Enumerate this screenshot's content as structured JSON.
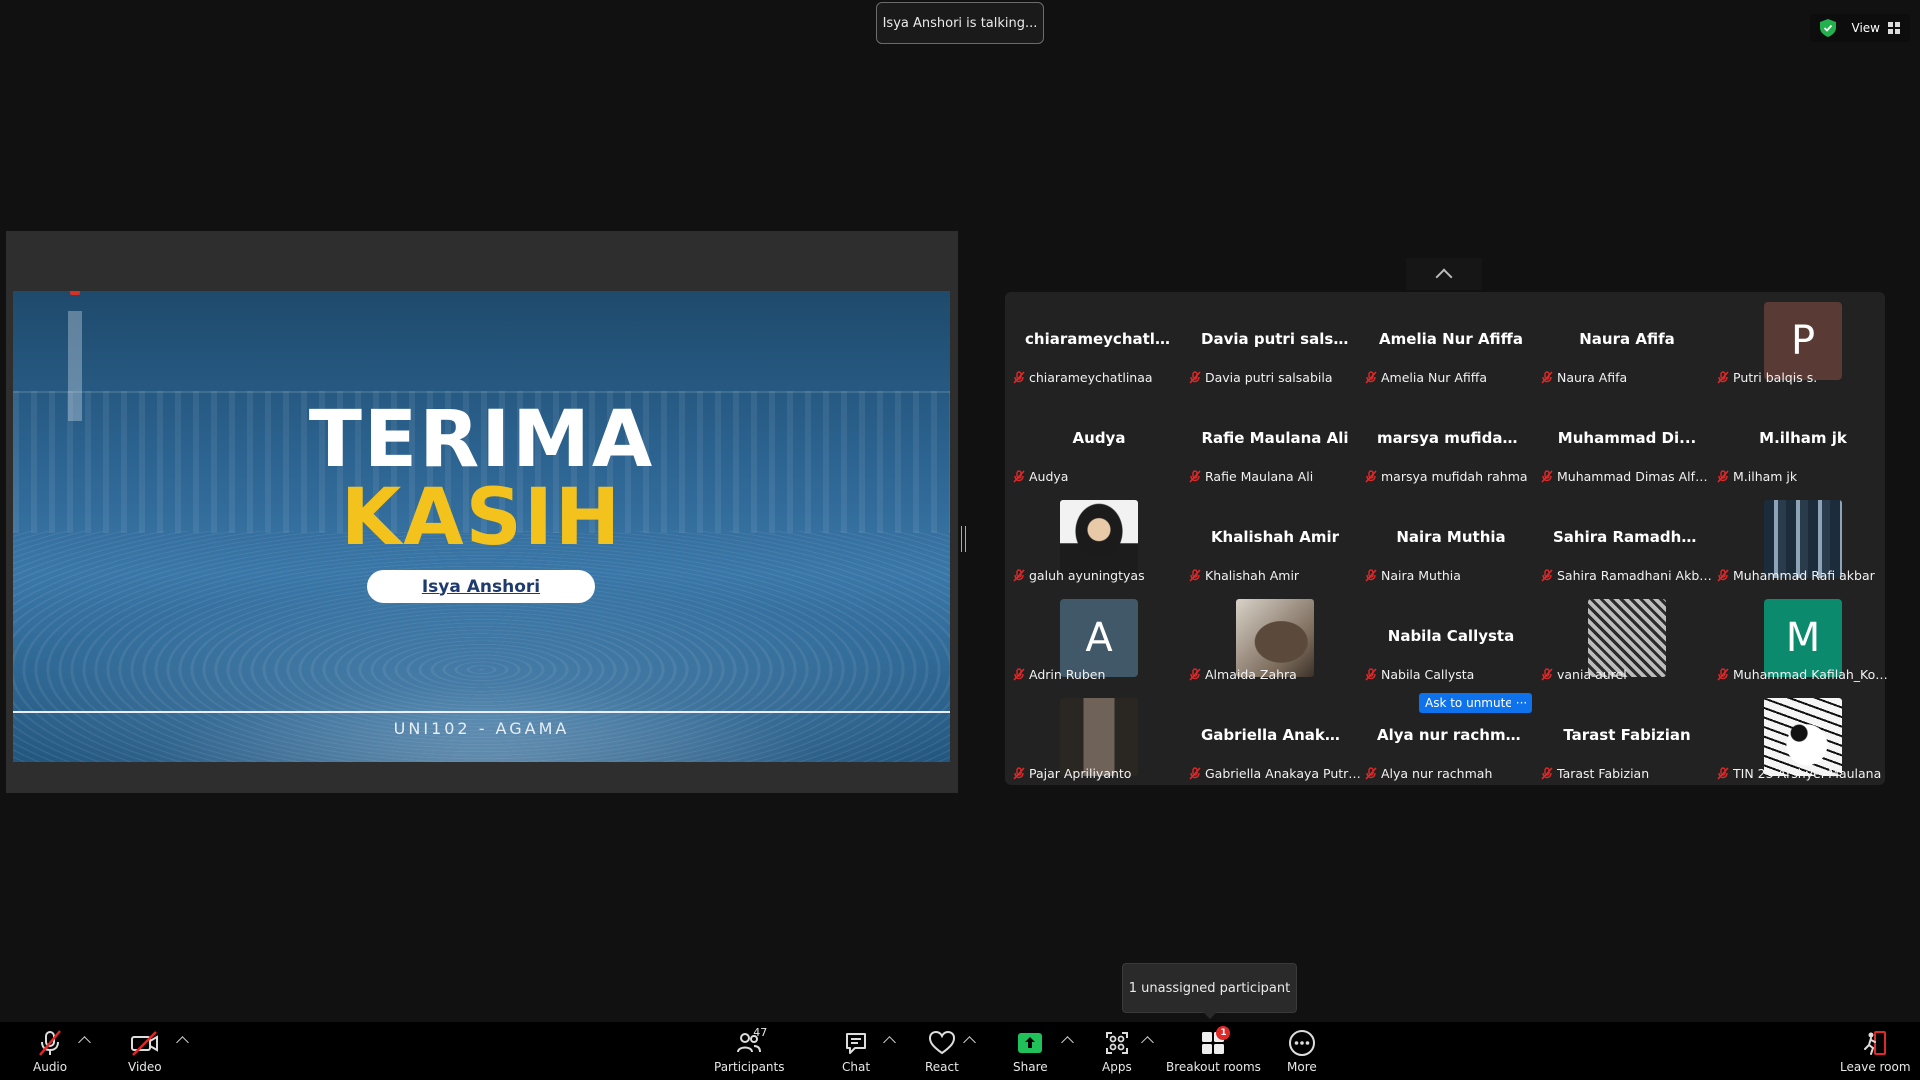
{
  "top": {
    "talking_toast": "Isya Anshori is talking...",
    "view_label": "View",
    "security_color": "#22b14c"
  },
  "slide": {
    "title_line1": "TERIMA",
    "title_line2": "KASIH",
    "presenter": "Isya Anshori",
    "course": "UNI102 - AGAMA",
    "title_color": "#ffffff",
    "accent_color": "#f3c21c"
  },
  "gallery": {
    "tiles": [
      {
        "big": "chiarameychatli...",
        "name": "chiarameychatlinaa"
      },
      {
        "big": "Davia putri sals...",
        "name": "Davia putri salsabila"
      },
      {
        "big": "Amelia Nur Afiffa",
        "name": "Amelia Nur Afiffa"
      },
      {
        "big": "Naura Afifa",
        "name": "Naura Afifa"
      },
      {
        "avatar": "P",
        "avatar_color": "#5a3a35",
        "name": "Putri balqis s."
      },
      {
        "big": "Audya",
        "name": "Audya"
      },
      {
        "big": "Rafie Maulana Ali",
        "name": "Rafie Maulana Ali"
      },
      {
        "big": "marsya mufidah...",
        "name": "marsya mufidah rahma"
      },
      {
        "big": "Muhammad Di...",
        "name": "Muhammad Dimas Alfar..."
      },
      {
        "big": "M.ilham jk",
        "name": "M.ilham jk"
      },
      {
        "photo": "person-hijab",
        "name": "galuh ayuningtyas"
      },
      {
        "big": "Khalishah Amir",
        "name": "Khalishah Amir"
      },
      {
        "big": "Naira Muthia",
        "name": "Naira Muthia"
      },
      {
        "big": "Sahira Ramadha...",
        "name": "Sahira Ramadhani Akbari"
      },
      {
        "photo": "group",
        "name": "Muhammad Rafi akbar"
      },
      {
        "avatar": "A",
        "avatar_color": "#415868",
        "name": "Adrin Ruben"
      },
      {
        "photo": "cat",
        "name": "Almaida Zahra"
      },
      {
        "big": "Nabila Callysta",
        "name": "Nabila Callysta"
      },
      {
        "photo": "sketch",
        "name": "vania aurel"
      },
      {
        "avatar": "M",
        "avatar_color": "#0c8a6e",
        "name": "Muhammad Kafilah_Kot..."
      },
      {
        "photo": "mirror",
        "name": "Pajar Apriliyanto"
      },
      {
        "big": "Gabriella Anaka...",
        "name": "Gabriella Anakaya Putri ..."
      },
      {
        "big": "Alya nur rachmah",
        "name": "Alya nur rachmah"
      },
      {
        "big": "Tarast Fabizian",
        "name": "Tarast Fabizian"
      },
      {
        "photo": "manga",
        "name": "TIN 23 Arshyel Maulana"
      }
    ],
    "ask_unmute_label": "Ask to unmute",
    "more_label": "···",
    "mute_color": "#e02828"
  },
  "tooltip": {
    "unassigned": "1 unassigned participant"
  },
  "toolbar": {
    "audio": "Audio",
    "video": "Video",
    "participants": "Participants",
    "participants_count": "47",
    "chat": "Chat",
    "react": "React",
    "share": "Share",
    "apps": "Apps",
    "breakout": "Breakout rooms",
    "breakout_badge": "1",
    "more": "More",
    "leave": "Leave room",
    "share_color": "#21c15a"
  }
}
